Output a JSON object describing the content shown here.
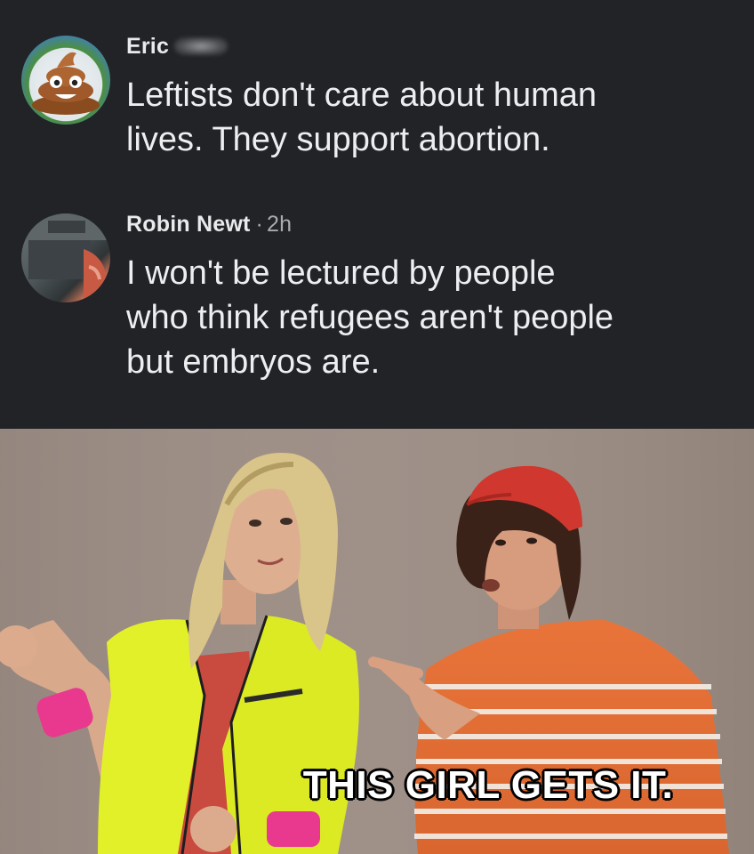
{
  "comments": [
    {
      "author": "Eric",
      "avatar_icon": "poop-emoji-icon",
      "name_redacted": true,
      "lines": [
        "Leftists don't care about human",
        "lives. They support abortion."
      ]
    },
    {
      "author": "Robin Newt",
      "separator": "·",
      "time": "2h",
      "avatar_icon": "profile-photo",
      "lines": [
        "I won't be lectured by people",
        "who think refugees aren't people",
        "but embryos are."
      ]
    }
  ],
  "meme": {
    "caption": "THIS GIRL GETS IT."
  }
}
